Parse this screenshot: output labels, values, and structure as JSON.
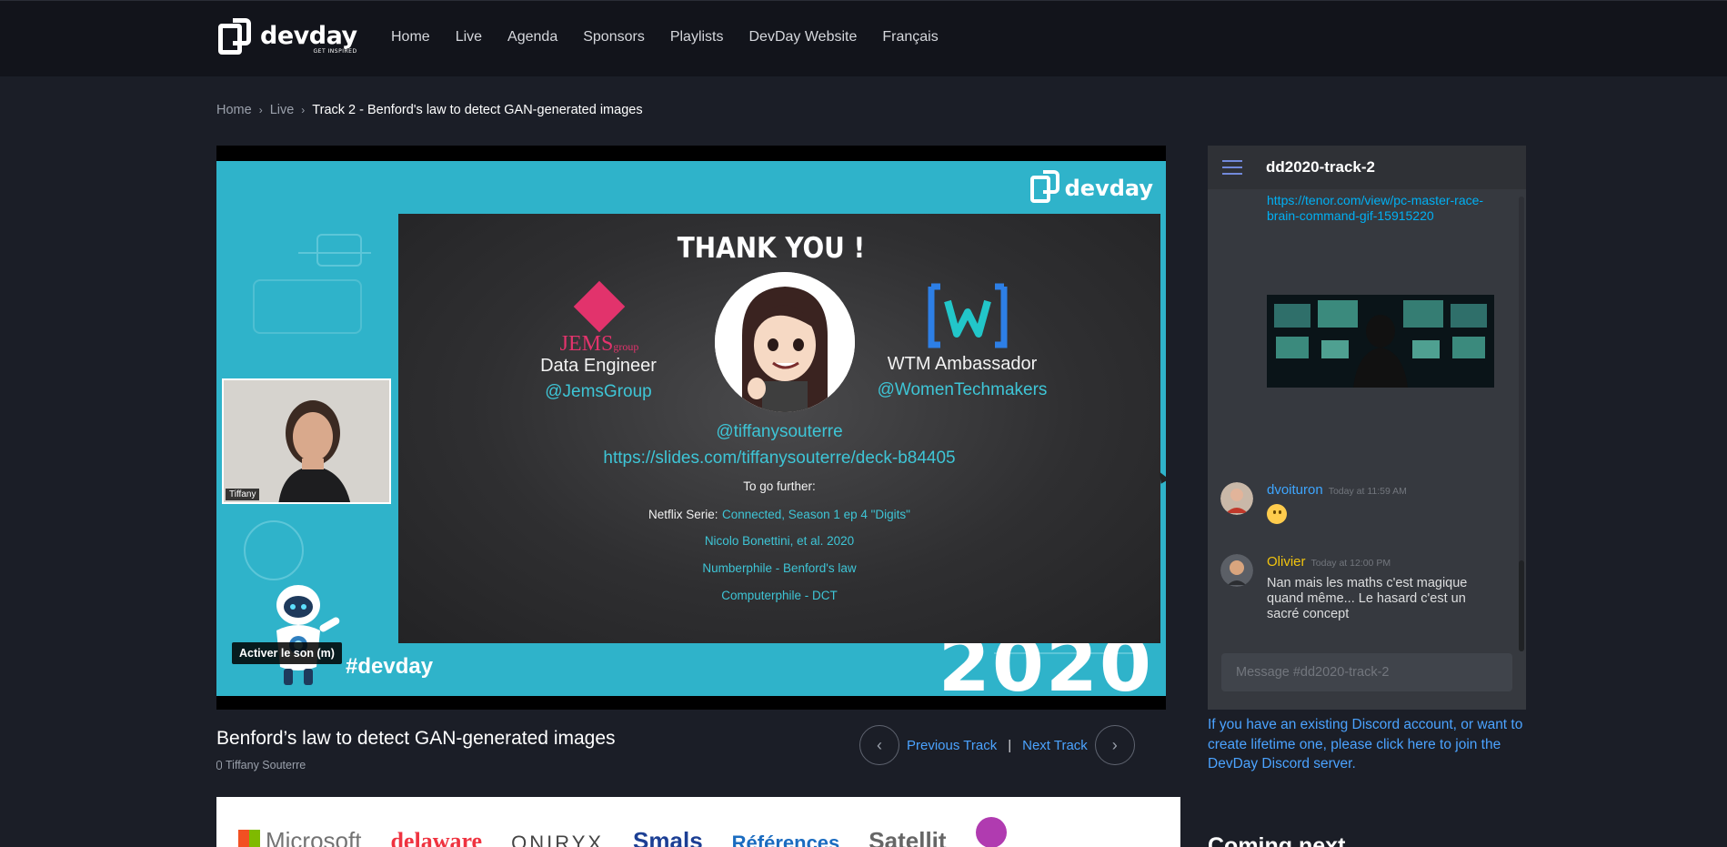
{
  "nav": {
    "logo_text": "devday",
    "logo_tagline": "GET INSPIRED",
    "items": [
      {
        "label": "Home"
      },
      {
        "label": "Live"
      },
      {
        "label": "Agenda"
      },
      {
        "label": "Sponsors"
      },
      {
        "label": "Playlists"
      },
      {
        "label": "DevDay Website"
      },
      {
        "label": "Français"
      }
    ]
  },
  "breadcrumb": {
    "items": [
      "Home",
      "Live"
    ],
    "current": "Track 2 - Benford's law to detect GAN-generated images"
  },
  "video": {
    "slide_logo": "devday",
    "hashtag": "#devday",
    "year": "2020",
    "thanks": "THANK YOU !",
    "left_company": "JEMS",
    "left_company_sub": "group",
    "left_role": "Data Engineer",
    "left_handle": "@JemsGroup",
    "right_role": "WTM Ambassador",
    "right_handle": "@WomenTechmakers",
    "speaker_handle": "@tiffanysouterre",
    "deck_url": "https://slides.com/tiffanysouterre/deck-b84405",
    "go_further": "To go further:",
    "netflix_label": "Netflix Serie:",
    "netflix_link": "Connected, Season 1 ep 4 \"Digits\"",
    "ref1": "Nicolo Bonettini, et al. 2020",
    "ref2": "Numberphile - Benford's law",
    "ref3": "Computerphile - DCT",
    "pip_label": "Tiffany",
    "unmute_label": "Activer le son (m)"
  },
  "talk": {
    "title": "Benford’s law to detect GAN-generated images",
    "speaker": "Tiffany Souterre",
    "prev_label": "Previous Track",
    "next_label": "Next Track",
    "separator": "|"
  },
  "sponsors": [
    "Microsoft",
    "delaware",
    "ONIRYX",
    "Smals",
    "Références",
    "Satellit"
  ],
  "chat": {
    "channel": "dd2020-track-2",
    "link": "https://tenor.com/view/pc-master-race-brain-command-gif-15915220",
    "messages": [
      {
        "author": "dvoituron",
        "time": "Today at 11:59 AM",
        "text": ""
      },
      {
        "author": "Olivier",
        "time": "Today at 12:00 PM",
        "text": "Nan mais les maths c'est magique quand même... Le hasard c'est un sacré concept"
      }
    ],
    "input_placeholder": "Message #dd2020-track-2"
  },
  "discord_note": "If you have an existing Discord account, or want to create lifetime one, please click here to join the DevDay Discord server.",
  "coming_next": "Coming next",
  "colors": {
    "accent_link": "#4ba3ff",
    "cyan": "#3ec5d6",
    "author_blue": "#3ea6ff",
    "author_gold": "#f1c40f"
  }
}
